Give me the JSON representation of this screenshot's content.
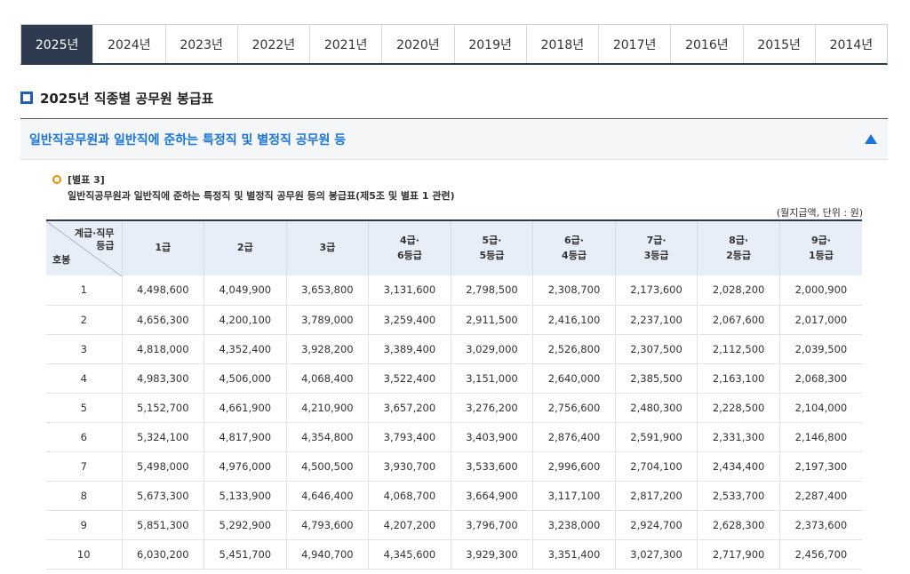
{
  "tabs": [
    "2025년",
    "2024년",
    "2023년",
    "2022년",
    "2021년",
    "2020년",
    "2019년",
    "2018년",
    "2017년",
    "2016년",
    "2015년",
    "2014년"
  ],
  "active_tab": "2025년",
  "page_title": "2025년 직종별 공무원 봉급표",
  "accordion": {
    "title": "일반직공무원과 일반직에 준하는 특정직 및 별정직 공무원 등",
    "expanded": true
  },
  "note": {
    "label": "[별표 3]",
    "description": "일반직공무원과 일반직에 준하는 특정직 및 별정직 공무원 등의 봉급표(제5조 및 별표 1 관련)",
    "unit": "(월지급액, 단위 : 원)"
  },
  "table": {
    "corner": {
      "top_line1": "계급·직무",
      "top_line2": "등급",
      "bottom": "호봉"
    },
    "headers": [
      [
        "1급"
      ],
      [
        "2급"
      ],
      [
        "3급"
      ],
      [
        "4급·",
        "6등급"
      ],
      [
        "5급·",
        "5등급"
      ],
      [
        "6급·",
        "4등급"
      ],
      [
        "7급·",
        "3등급"
      ],
      [
        "8급·",
        "2등급"
      ],
      [
        "9급·",
        "1등급"
      ]
    ],
    "rows": [
      [
        "1",
        "4,498,600",
        "4,049,900",
        "3,653,800",
        "3,131,600",
        "2,798,500",
        "2,308,700",
        "2,173,600",
        "2,028,200",
        "2,000,900"
      ],
      [
        "2",
        "4,656,300",
        "4,200,100",
        "3,789,000",
        "3,259,400",
        "2,911,500",
        "2,416,100",
        "2,237,100",
        "2,067,600",
        "2,017,000"
      ],
      [
        "3",
        "4,818,000",
        "4,352,400",
        "3,928,200",
        "3,389,400",
        "3,029,000",
        "2,526,800",
        "2,307,500",
        "2,112,500",
        "2,039,500"
      ],
      [
        "4",
        "4,983,300",
        "4,506,000",
        "4,068,400",
        "3,522,400",
        "3,151,000",
        "2,640,000",
        "2,385,500",
        "2,163,100",
        "2,068,300"
      ],
      [
        "5",
        "5,152,700",
        "4,661,900",
        "4,210,900",
        "3,657,200",
        "3,276,200",
        "2,756,600",
        "2,480,300",
        "2,228,500",
        "2,104,000"
      ],
      [
        "6",
        "5,324,100",
        "4,817,900",
        "4,354,800",
        "3,793,400",
        "3,403,900",
        "2,876,400",
        "2,591,900",
        "2,331,300",
        "2,146,800"
      ],
      [
        "7",
        "5,498,000",
        "4,976,000",
        "4,500,500",
        "3,930,700",
        "3,533,600",
        "2,996,600",
        "2,704,100",
        "2,434,400",
        "2,197,300"
      ],
      [
        "8",
        "5,673,300",
        "5,133,900",
        "4,646,400",
        "4,068,700",
        "3,664,900",
        "3,117,100",
        "2,817,200",
        "2,533,700",
        "2,287,400"
      ],
      [
        "9",
        "5,851,300",
        "5,292,900",
        "4,793,600",
        "4,207,200",
        "3,796,700",
        "3,238,000",
        "2,924,700",
        "2,628,300",
        "2,373,600"
      ],
      [
        "10",
        "6,030,200",
        "5,451,700",
        "4,940,700",
        "4,345,600",
        "3,929,300",
        "3,351,400",
        "3,027,300",
        "2,717,900",
        "2,456,700"
      ]
    ]
  },
  "colors": {
    "tab_active_bg": "#2e3b4e",
    "accent_blue": "#1a73d9",
    "header_bg": "#e7eef7",
    "circle_orange": "#f08c00"
  },
  "icons": {
    "title": "square-bullet-icon",
    "note": "circle-bullet-icon",
    "toggle": "triangle-up-icon"
  }
}
